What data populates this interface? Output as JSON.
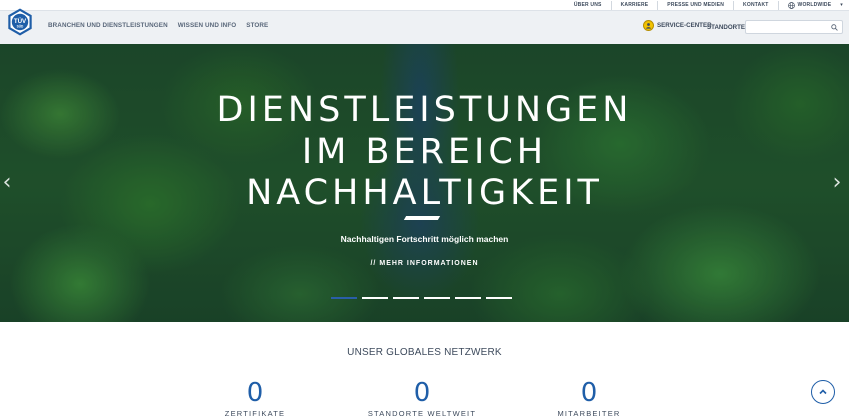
{
  "header": {
    "top_links": [
      "ÜBER UNS",
      "KARRIERE",
      "PRESSE UND MEDIEN",
      "KONTAKT"
    ],
    "worldwide_label": "WORLDWIDE",
    "logo_text": "TÜV",
    "logo_subtext": "SÜD",
    "nav": [
      "BRANCHEN UND DIENSTLEISTUNGEN",
      "WISSEN UND INFO",
      "STORE"
    ],
    "service_center_label": "SERVICE-CENTER",
    "standorte_label": "STANDORTE",
    "search_placeholder": ""
  },
  "hero": {
    "title_lines": [
      "DIENSTLEISTUNGEN",
      "IM BEREICH",
      "NACHHALTIGKEIT"
    ],
    "subtitle": "Nachhaltigen Fortschritt möglich machen",
    "cta_prefix": "//",
    "cta_label": "MEHR INFORMATIONEN",
    "slides_total": 6,
    "active_slide": 1
  },
  "network": {
    "title": "UNSER GLOBALES NETZWERK",
    "stats": [
      {
        "value": "0",
        "label": "ZERTIFIKATE"
      },
      {
        "value": "0",
        "label": "STANDORTE WELTWEIT"
      },
      {
        "value": "0",
        "label": "MITARBEITER"
      }
    ]
  },
  "colors": {
    "brand_blue": "#1f5ea8",
    "header_bg": "#eef1f4",
    "service_icon": "#f2c200"
  },
  "icons": [
    "globe-icon",
    "chevron-down-icon",
    "search-icon",
    "service-center-icon",
    "chevron-left-icon",
    "chevron-right-icon",
    "arrow-up-icon"
  ]
}
